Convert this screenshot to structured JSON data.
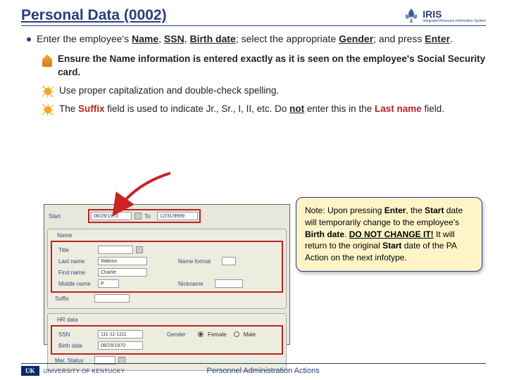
{
  "header": {
    "title": "Personal Data (0002)",
    "logo_text": "IRIS",
    "logo_sub": "Integrated Resource Information System"
  },
  "main": {
    "intro_a": "Enter the employee's ",
    "intro_name": "Name",
    "intro_sep1": ", ",
    "intro_ssn": "SSN",
    "intro_sep2": ", ",
    "intro_bdate": "Birth date",
    "intro_b": "; select the appropriate ",
    "intro_gender": "Gender",
    "intro_c": "; and press ",
    "intro_enter": "Enter",
    "intro_d": "."
  },
  "subs": {
    "s1": "Ensure the Name information is entered exactly as it is seen on the employee's Social Security card.",
    "s2": "Use proper capitalization and double-check spelling.",
    "s3a": "The ",
    "s3_suffix": "Suffix",
    "s3b": " field is used to indicate Jr., Sr., I, II, etc.  Do ",
    "s3_not": "not",
    "s3c": " enter this in the ",
    "s3_last": "Last name",
    "s3d": " field."
  },
  "callout": {
    "a": "Note:  Upon pressing ",
    "enter": "Enter",
    "b": ", the ",
    "start": "Start",
    "c": " date will temporarily change to the employee's ",
    "bdate": "Birth date",
    "d": ".  ",
    "warn": "DO NOT CHANGE IT!",
    "e": "  It will return to the original ",
    "start2": "Start",
    "f": " date of the PA Action on the next infotype."
  },
  "sap": {
    "start_lbl": "Start",
    "start_val": "08/29/1970",
    "to_lbl": "To",
    "to_val": "12/31/9999",
    "name_sec": "Name",
    "title_lbl": "Title",
    "last_lbl": "Last name",
    "last_val": "Watson",
    "first_lbl": "First name",
    "first_val": "Charlie",
    "middle_lbl": "Middle name",
    "middle_val": "P",
    "suffix_lbl": "Suffix",
    "nameformat_lbl": "Name format",
    "nickname_lbl": "Nickname",
    "hr_sec": "HR data",
    "ssn_lbl": "SSN",
    "ssn_val": "111-11-1111",
    "gender_lbl": "Gender",
    "female": "Female",
    "male": "Male",
    "bdate_lbl": "Birth date",
    "bdate_val": "08/29/1970",
    "mar_lbl": "Mar. Status"
  },
  "footer": {
    "uk": "UK",
    "uk_name": "UNIVERSITY OF KENTUCKY",
    "title": "Personnel Administration Actions"
  }
}
